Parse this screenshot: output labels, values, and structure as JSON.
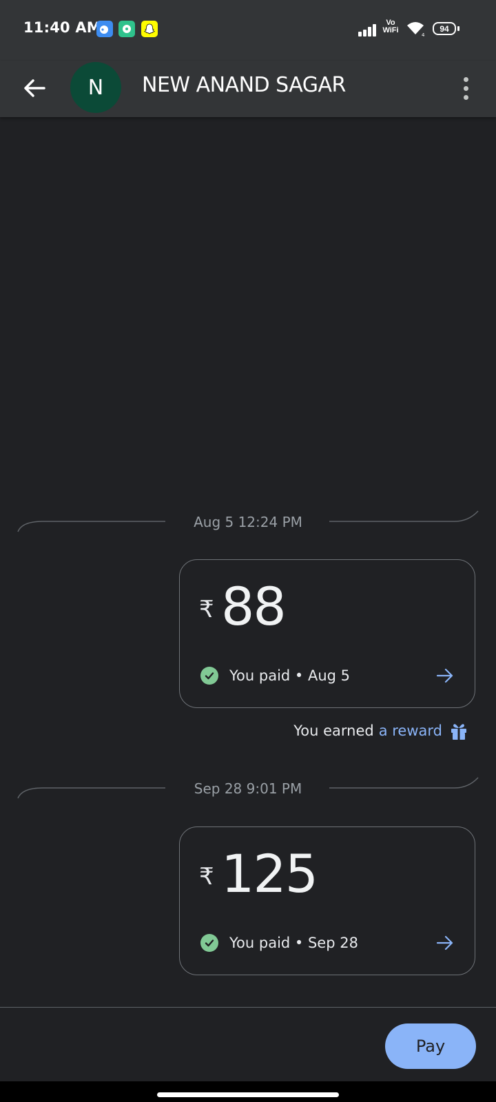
{
  "status_bar": {
    "time": "11:40 AM",
    "app_icons": [
      "messenger-style-icon",
      "clock-app-icon",
      "snapchat-icon"
    ],
    "vo_label": "Vo",
    "wifi_label": "WiFi",
    "battery": "94"
  },
  "header": {
    "avatar_letter": "N",
    "title": "NEW ANAND SAGAR"
  },
  "transactions": [
    {
      "date_time": "Aug 5 12:24 PM",
      "currency": "₹",
      "amount": "88",
      "status": "You paid • Aug 5"
    },
    {
      "date_time": "Sep 28 9:01 PM",
      "currency": "₹",
      "amount": "125",
      "status": "You paid • Sep 28"
    }
  ],
  "reward": {
    "prefix": "You earned",
    "link": "a reward"
  },
  "pay_button": {
    "label": "Pay"
  },
  "colors": {
    "background": "#202124",
    "header": "#333537",
    "accent": "#8ab4f8",
    "success": "#81c995",
    "avatar": "#0b4a37"
  }
}
